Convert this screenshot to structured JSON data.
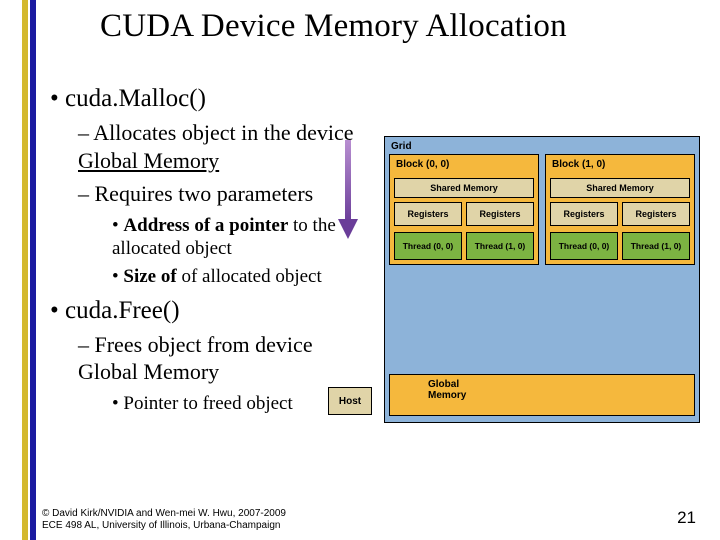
{
  "title": "CUDA Device Memory Allocation",
  "malloc": {
    "fn": "cuda.Malloc()",
    "line1a": "– Allocates object in the device",
    "line1b": "Global Memory",
    "line2": "– Requires two parameters",
    "sub_a_bold": "Address of a pointer",
    "sub_a_rest": " to the allocated object",
    "sub_b_bold": "Size of",
    "sub_b_rest": " of allocated object"
  },
  "free": {
    "fn": "cuda.Free()",
    "line1a": "– Frees object from device",
    "line1b": "Global Memory",
    "sub": "Pointer to freed object"
  },
  "diagram": {
    "grid": "Grid",
    "b00": "Block (0, 0)",
    "b10": "Block (1, 0)",
    "shared": "Shared Memory",
    "reg": "Registers",
    "t00": "Thread (0, 0)",
    "t10": "Thread (1, 0)",
    "global": "Global Memory",
    "host": "Host"
  },
  "footer": {
    "l1": "© David Kirk/NVIDIA and Wen-mei W. Hwu, 2007-2009",
    "l2": "ECE 498 AL, University of Illinois, Urbana-Champaign"
  },
  "page": "21"
}
